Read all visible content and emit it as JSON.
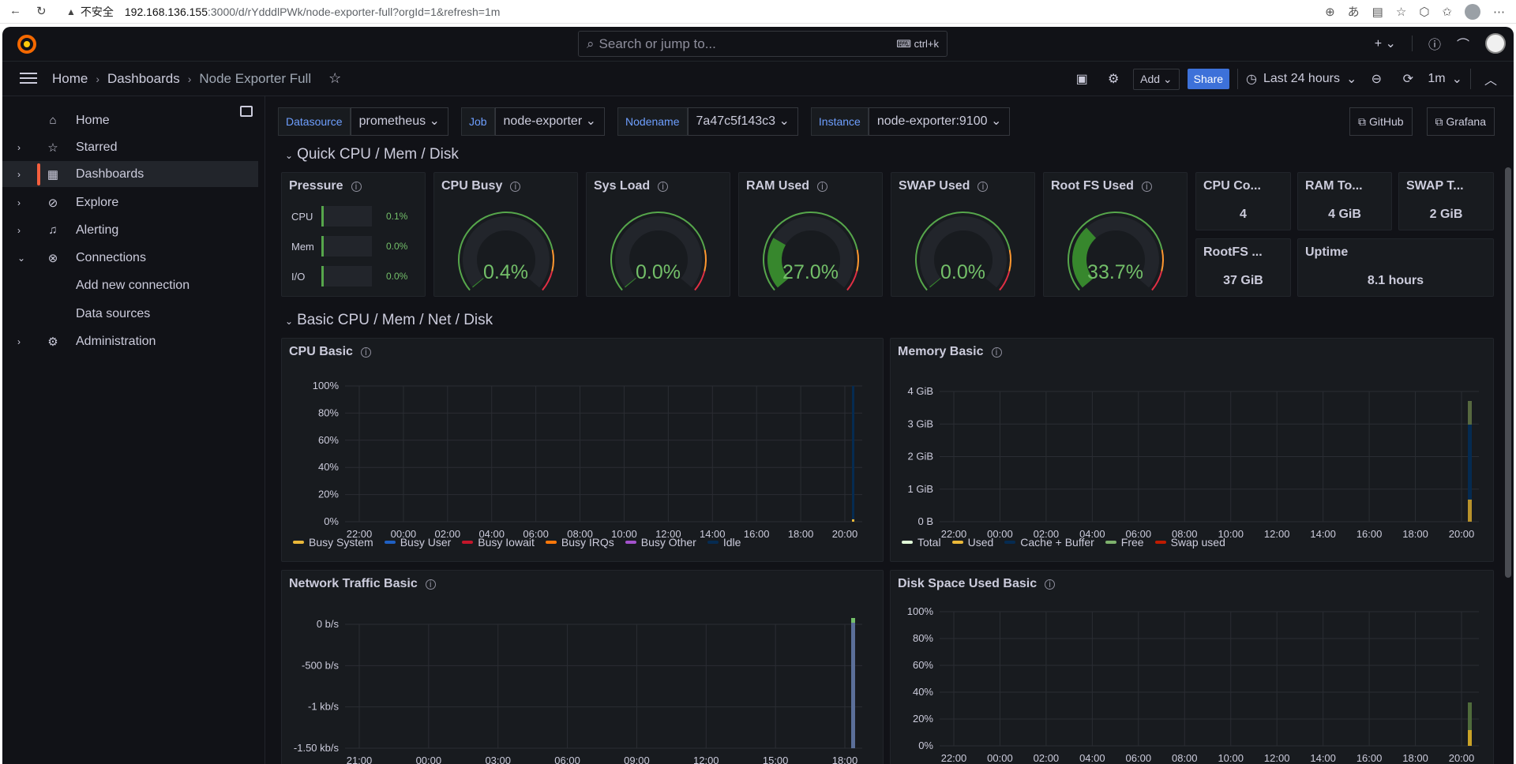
{
  "browser": {
    "security_icon": "warning-triangle-icon",
    "security_label": "不安全",
    "url_host": "192.168.136.155",
    "url_path": ":3000/d/rYdddlPWk/node-exporter-full?orgId=1&refresh=1m"
  },
  "topbar": {
    "search_placeholder": "Search or jump to...",
    "search_shortcut": "ctrl+k"
  },
  "breadcrumb": {
    "home": "Home",
    "dashboards": "Dashboards",
    "current": "Node Exporter Full"
  },
  "toolbar": {
    "add_label": "Add",
    "share_label": "Share",
    "time_range": "Last 24 hours",
    "refresh_interval": "1m"
  },
  "sidebar": {
    "items": [
      {
        "label": "Home",
        "icon": "home-icon"
      },
      {
        "label": "Starred",
        "icon": "star-icon"
      },
      {
        "label": "Dashboards",
        "icon": "apps-icon"
      },
      {
        "label": "Explore",
        "icon": "compass-icon"
      },
      {
        "label": "Alerting",
        "icon": "bell-icon"
      },
      {
        "label": "Connections",
        "icon": "link-icon"
      },
      {
        "label": "Add new connection"
      },
      {
        "label": "Data sources"
      },
      {
        "label": "Administration",
        "icon": "cog-icon"
      }
    ]
  },
  "variables": [
    {
      "label": "Datasource",
      "value": "prometheus"
    },
    {
      "label": "Job",
      "value": "node-exporter"
    },
    {
      "label": "Nodename",
      "value": "7a47c5f143c3"
    },
    {
      "label": "Instance",
      "value": "node-exporter:9100"
    }
  ],
  "links": {
    "github": "GitHub",
    "grafana": "Grafana"
  },
  "rows": {
    "quick": "Quick CPU / Mem / Disk",
    "basic": "Basic CPU / Mem / Net / Disk"
  },
  "pressure": {
    "title": "Pressure",
    "items": [
      {
        "label": "CPU",
        "value": "0.1%"
      },
      {
        "label": "Mem",
        "value": "0.0%"
      },
      {
        "label": "I/O",
        "value": "0.0%"
      }
    ]
  },
  "gauges": [
    {
      "title": "CPU Busy",
      "value": "0.4%",
      "fraction": 0.004
    },
    {
      "title": "Sys Load",
      "value": "0.0%",
      "fraction": 0.0
    },
    {
      "title": "RAM Used",
      "value": "27.0%",
      "fraction": 0.27
    },
    {
      "title": "SWAP Used",
      "value": "0.0%",
      "fraction": 0.0
    },
    {
      "title": "Root FS Used",
      "value": "33.7%",
      "fraction": 0.337
    }
  ],
  "stats": {
    "cpu_cores": {
      "title": "CPU Co...",
      "value": "4"
    },
    "ram_total": {
      "title": "RAM To...",
      "value": "4 GiB"
    },
    "swap_total": {
      "title": "SWAP T...",
      "value": "2 GiB"
    },
    "rootfs_total": {
      "title": "RootFS ...",
      "value": "37 GiB"
    },
    "uptime": {
      "title": "Uptime",
      "value": "8.1 hours"
    }
  },
  "charts": {
    "cpu": {
      "title": "CPU Basic",
      "y_ticks": [
        "100%",
        "80%",
        "60%",
        "40%",
        "20%",
        "0%"
      ],
      "x_ticks": [
        "22:00",
        "00:00",
        "02:00",
        "04:00",
        "06:00",
        "08:00",
        "10:00",
        "12:00",
        "14:00",
        "16:00",
        "18:00",
        "20:00"
      ],
      "legend": [
        {
          "name": "Busy System",
          "color": "#eab839"
        },
        {
          "name": "Busy User",
          "color": "#1f60c4"
        },
        {
          "name": "Busy Iowait",
          "color": "#c4162a"
        },
        {
          "name": "Busy IRQs",
          "color": "#ff780a"
        },
        {
          "name": "Busy Other",
          "color": "#a352cc"
        },
        {
          "name": "Idle",
          "color": "#052b51"
        }
      ]
    },
    "memory": {
      "title": "Memory Basic",
      "y_ticks": [
        "4 GiB",
        "3 GiB",
        "2 GiB",
        "1 GiB",
        "0 B"
      ],
      "x_ticks": [
        "22:00",
        "00:00",
        "02:00",
        "04:00",
        "06:00",
        "08:00",
        "10:00",
        "12:00",
        "14:00",
        "16:00",
        "18:00",
        "20:00"
      ],
      "legend": [
        {
          "name": "Total",
          "color": "#e0f9d7"
        },
        {
          "name": "Used",
          "color": "#eab839"
        },
        {
          "name": "Cache + Buffer",
          "color": "#052b51"
        },
        {
          "name": "Free",
          "color": "#7eb26d"
        },
        {
          "name": "Swap used",
          "color": "#bf1b00"
        }
      ]
    },
    "network": {
      "title": "Network Traffic Basic",
      "y_ticks": [
        "0 b/s",
        "-500 b/s",
        "-1 kb/s",
        "-1.50 kb/s"
      ],
      "x_ticks": [
        "21:00",
        "00:00",
        "03:00",
        "06:00",
        "09:00",
        "12:00",
        "15:00",
        "18:00"
      ]
    },
    "disk": {
      "title": "Disk Space Used Basic",
      "y_ticks": [
        "100%",
        "80%",
        "60%",
        "40%",
        "20%",
        "0%"
      ],
      "x_ticks": [
        "22:00",
        "00:00",
        "02:00",
        "04:00",
        "06:00",
        "08:00",
        "10:00",
        "12:00",
        "14:00",
        "16:00",
        "18:00",
        "20:00"
      ]
    }
  }
}
